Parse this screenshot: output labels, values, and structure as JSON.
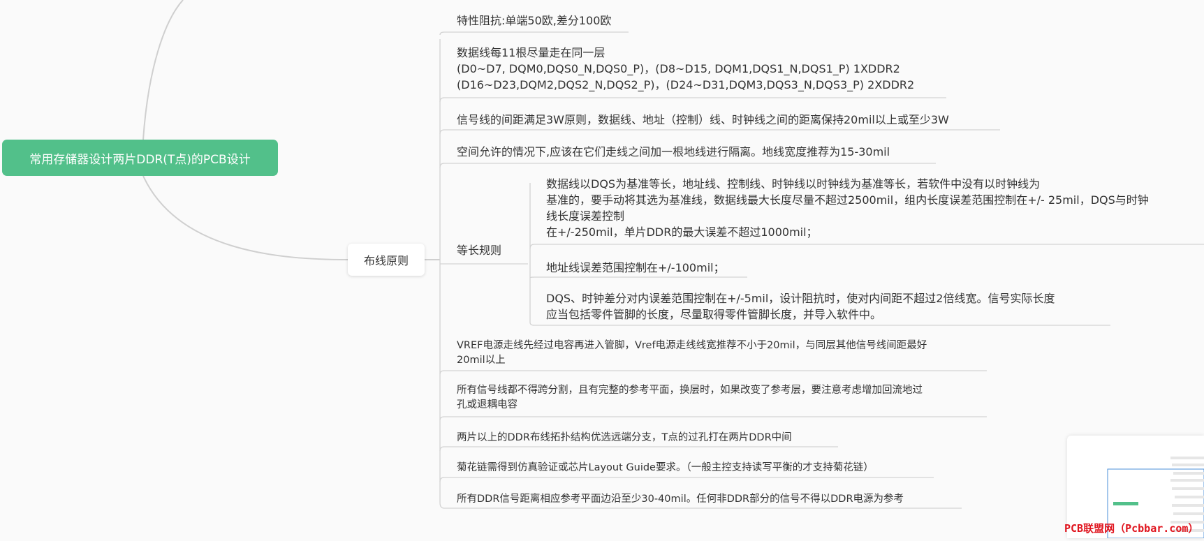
{
  "root": {
    "label": "常用存储器设计两片DDR(T点)的PCB设计"
  },
  "branch": {
    "label": "布线原则"
  },
  "items": {
    "impedance": "特性阻抗:单端50欧,差分100欧",
    "data_lines": "数据线每11根尽量走在同一层\n(D0~D7, DQM0,DQS0_N,DQS0_P)，(D8~D15, DQM1,DQS1_N,DQS1_P) 1XDDR2\n(D16~D23,DQM2,DQS2_N,DQS2_P)，(D24~D31,DQM3,DQS3_N,DQS3_P) 2XDDR2",
    "spacing_3w": "信号线的间距满足3W原则，数据线、地址（控制）线、时钟线之间的距离保持20mil以上或至少3W",
    "ground_line": "空间允许的情况下,应该在它们走线之间加一根地线进行隔离。地线宽度推荐为15-30mil",
    "equal_length": {
      "label": "等长规则",
      "children": [
        "数据线以DQS为基准等长，地址线、控制线、时钟线以时钟线为基准等长，若软件中没有以时钟线为\n基准的，要手动将其选为基准线，数据线最大长度尽量不超过2500mil，组内长度误差范围控制在+/- 25mil，DQS与时钟\n线长度误差控制\n在+/-250mil，单片DDR的最大误差不超过1000mil；",
        "地址线误差范围控制在+/-100mil；",
        "DQS、时钟差分对内误差范围控制在+/-5mil，设计阻抗时，使对内间距不超过2倍线宽。信号实际长度\n应当包括零件管脚的长度，尽量取得零件管脚长度，并导入软件中。"
      ]
    },
    "vref": "VREF电源走线先经过电容再进入管脚，Vref电源走线线宽推荐不小于20mil，与同层其他信号线间距最好\n20mil以上",
    "no_split": "所有信号线都不得跨分割，且有完整的参考平面，换层时，如果改变了参考层，要注意考虑增加回流地过\n孔或退耦电容",
    "topology": "两片以上的DDR布线拓扑结构优选远端分支，T点的过孔打在两片DDR中间",
    "daisy_chain": "菊花链需得到仿真验证或芯片Layout Guide要求。（一般主控支持读写平衡的才支持菊花链）",
    "ref_plane": "所有DDR信号距离相应参考平面边沿至少30-40mil。任何非DDR部分的信号不得以DDR电源为参考"
  },
  "watermark": "PCB联盟网（Pcbbar.com）",
  "colors": {
    "root_fill": "#52c08a",
    "line": "#cfcfcf",
    "background": "#fafafa",
    "watermark": "#e0141e"
  }
}
